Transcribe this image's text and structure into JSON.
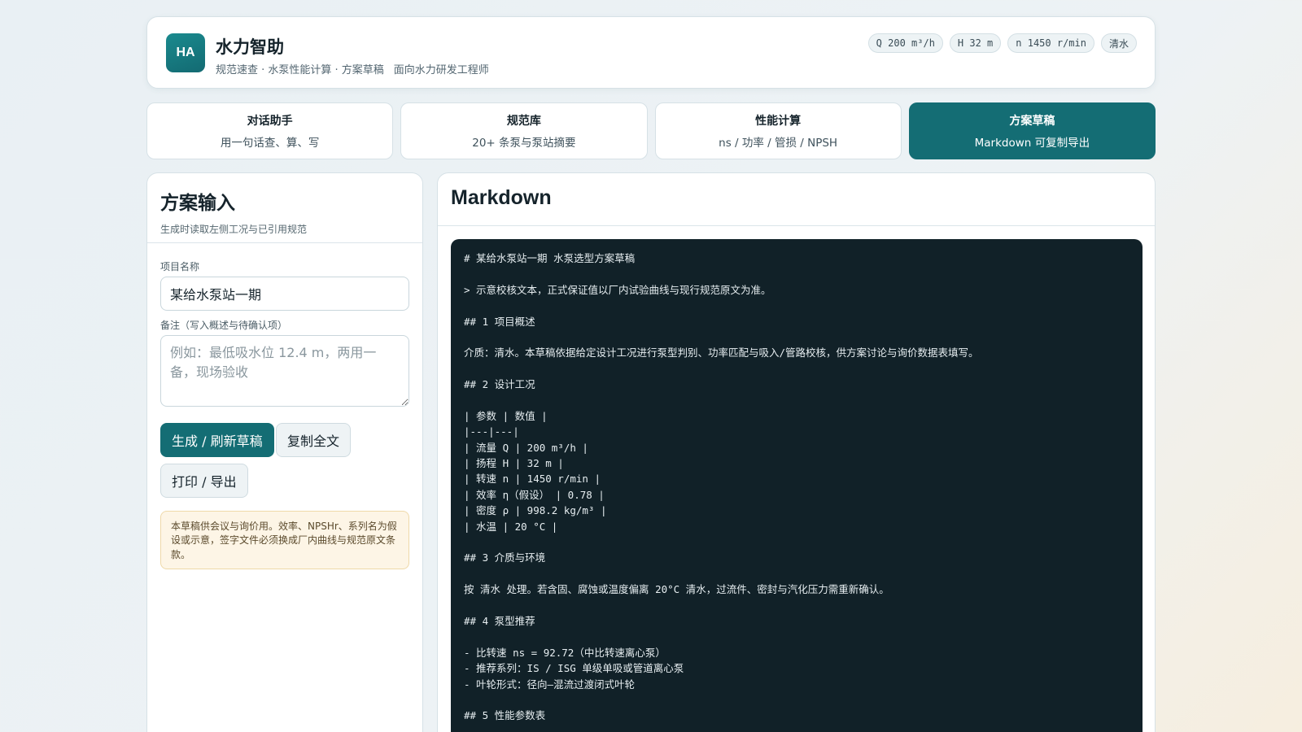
{
  "header": {
    "logo": "HA",
    "title": "水力智助",
    "subtitle": "规范速查 · 水泵性能计算 · 方案草稿",
    "audience": "面向水力研发工程师",
    "chips": [
      "Q 200 m³/h",
      "H 32 m",
      "n 1450 r/min",
      "清水"
    ]
  },
  "tabs": [
    {
      "title": "对话助手",
      "sub": "用一句话查、算、写"
    },
    {
      "title": "规范库",
      "sub": "20+ 条泵与泵站摘要"
    },
    {
      "title": "性能计算",
      "sub": "ns / 功率 / 管损 / NPSH"
    },
    {
      "title": "方案草稿",
      "sub": "Markdown 可复制导出"
    }
  ],
  "left": {
    "title": "方案输入",
    "subtitle": "生成时读取左侧工况与已引用规范",
    "project_label": "项目名称",
    "project_value": "某给水泵站一期",
    "notes_label": "备注（写入概述与待确认项）",
    "notes_placeholder": "例如：最低吸水位 12.4 m，两用一备，现场验收",
    "generate_label": "生成 / 刷新草稿",
    "copy_label": "复制全文",
    "print_label": "打印 / 导出",
    "notice": "本草稿供会议与询价用。效率、NPSHr、系列名为假设或示意，签字文件必须换成厂内曲线与规范原文条款。"
  },
  "right": {
    "title": "Markdown",
    "lines": [
      "# 某给水泵站一期 水泵选型方案草稿",
      "",
      "> 示意校核文本，正式保证值以厂内试验曲线与现行规范原文为准。",
      "",
      "## 1 项目概述",
      "",
      "介质：清水。本草稿依据给定设计工况进行泵型判别、功率匹配与吸入/管路校核，供方案讨论与询价数据表填写。",
      "",
      "## 2 设计工况",
      "",
      "| 参数 | 数值 |",
      "|---|---|",
      "| 流量 Q | 200 m³/h |",
      "| 扬程 H | 32 m |",
      "| 转速 n | 1450 r/min |",
      "| 效率 η（假设） | 0.78 |",
      "| 密度 ρ | 998.2 kg/m³ |",
      "| 水温 | 20 °C |",
      "",
      "## 3 介质与环境",
      "",
      "按 清水 处理。若含固、腐蚀或温度偏离 20°C 清水，过流件、密封与汽化压力需重新确认。",
      "",
      "## 4 泵型推荐",
      "",
      "- 比转速 ns = 92.72（中比转速离心泵）",
      "- 推荐系列：IS / ISG 单级单吸或管道离心泵",
      "- 叶轮形式：径向–混流过渡闭式叶轮",
      "",
      "## 5 性能参数表"
    ]
  }
}
